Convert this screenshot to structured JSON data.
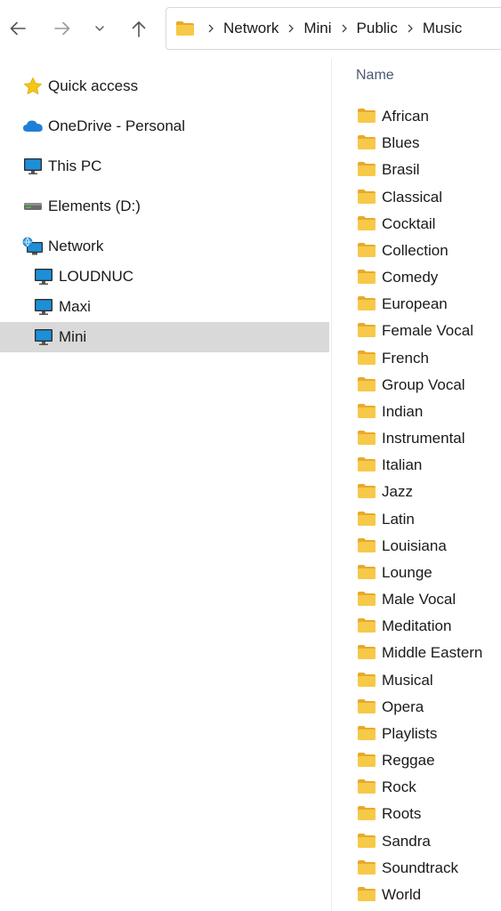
{
  "toolbar": {
    "icons": {
      "back": "arrow-left-icon",
      "forward": "arrow-right-icon",
      "recent": "chevron-down-icon",
      "up": "arrow-up-icon"
    }
  },
  "address": {
    "icon": "folder-icon",
    "path": [
      "Network",
      "Mini",
      "Public",
      "Music"
    ]
  },
  "sidebar": {
    "items": [
      {
        "label": "Quick access",
        "icon": "star-icon",
        "level": 0
      },
      {
        "label": "OneDrive - Personal",
        "icon": "cloud-icon",
        "level": 0
      },
      {
        "label": "This PC",
        "icon": "monitor-icon",
        "level": 0
      },
      {
        "label": "Elements (D:)",
        "icon": "drive-icon",
        "level": 0
      },
      {
        "label": "Network",
        "icon": "network-icon",
        "level": 0
      },
      {
        "label": "LOUDNUC",
        "icon": "monitor-icon",
        "level": 1
      },
      {
        "label": "Maxi",
        "icon": "monitor-icon",
        "level": 1
      },
      {
        "label": "Mini",
        "icon": "monitor-icon",
        "level": 1,
        "selected": true
      }
    ]
  },
  "content": {
    "column_header": "Name",
    "folders": [
      "African",
      "Blues",
      "Brasil",
      "Classical",
      "Cocktail",
      "Collection",
      "Comedy",
      "European",
      "Female Vocal",
      "French",
      "Group Vocal",
      "Indian",
      "Instrumental",
      "Italian",
      "Jazz",
      "Latin",
      "Louisiana",
      "Lounge",
      "Male Vocal",
      "Meditation",
      "Middle Eastern",
      "Musical",
      "Opera",
      "Playlists",
      "Reggae",
      "Rock",
      "Roots",
      "Sandra",
      "Soundtrack",
      "World"
    ]
  },
  "colors": {
    "selection": "#d9d9d9",
    "folder": "#f7c948",
    "folder_back": "#e8a92c",
    "header_text": "#4a5a73",
    "monitor_blue": "#1e8fd6"
  }
}
